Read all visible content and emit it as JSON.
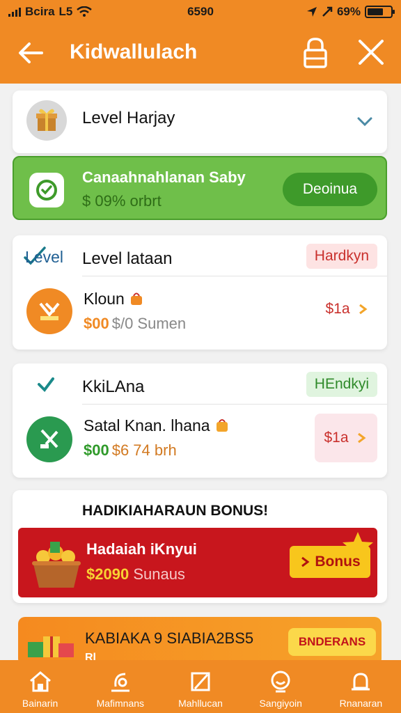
{
  "status_bar": {
    "carrier": "Bcira",
    "carrier_code": "L5",
    "time": "6590",
    "battery": "69%",
    "battery_level": 0.69
  },
  "app_bar": {
    "title": "Kidwallulach"
  },
  "level_select": {
    "label": "Level Harjay"
  },
  "promo": {
    "title": "Canaahnahlanan Saby",
    "subtitle": "$ 09% orbrt",
    "button": "Deoinua"
  },
  "level_cards": [
    {
      "head_logo": "Level",
      "head_title": "Level lataan",
      "badge": "Hardkyn",
      "item_name": "Kloun",
      "amount": "$00",
      "amount_rest": "$/0 Sumen",
      "price": "$1a"
    },
    {
      "head_logo": "",
      "head_title": "KkiLAna",
      "badge": "HEndkyi",
      "item_name": "Satal Knan. lhana",
      "amount": "$00",
      "amount_rest": "$6 74 brh",
      "price": "$1a"
    }
  ],
  "bonus_card": {
    "title": "HADIKIAHARAUN BONUS!",
    "name": "Hadaiah iKnyui",
    "amount": "$2090",
    "amount_rest": "Sunaus",
    "button": "Bonus"
  },
  "orange_card": {
    "title": "KABIAKA 9 SIABIA2BS5",
    "subtitle": "Rl",
    "button": "BNDERANS"
  },
  "bottom_nav": [
    {
      "label": "Bainarin",
      "icon": "home-icon"
    },
    {
      "label": "Mafimnans",
      "icon": "chart-icon"
    },
    {
      "label": "Mahllucan",
      "icon": "edit-icon"
    },
    {
      "label": "Sangiyoin",
      "icon": "smiley-icon"
    },
    {
      "label": "Rnanaran",
      "icon": "bell-icon"
    }
  ],
  "colors": {
    "primary": "#f08a24",
    "green": "#6fbf4a",
    "red": "#c8161d",
    "yellow": "#f8c61c"
  }
}
